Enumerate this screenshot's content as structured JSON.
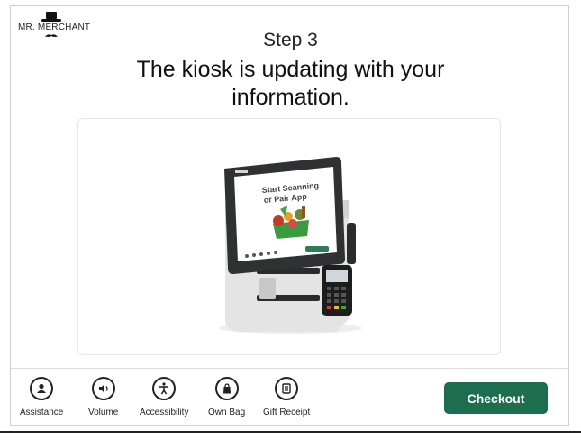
{
  "brand": {
    "name": "MR. MERCHANT"
  },
  "header": {
    "step": "Step 3",
    "message": "The kiosk is updating with your information."
  },
  "kiosk_screen": {
    "line1": "Start Scanning",
    "line2": "or Pair App"
  },
  "toolbar": {
    "items": [
      {
        "label": "Assistance",
        "icon": "person-icon"
      },
      {
        "label": "Volume",
        "icon": "speaker-icon"
      },
      {
        "label": "Accessibility",
        "icon": "accessibility-icon"
      },
      {
        "label": "Own Bag",
        "icon": "bag-icon"
      },
      {
        "label": "Gift Receipt",
        "icon": "receipt-icon"
      }
    ],
    "checkout_label": "Checkout"
  },
  "colors": {
    "accent": "#1d6e4f",
    "text": "#222222"
  }
}
